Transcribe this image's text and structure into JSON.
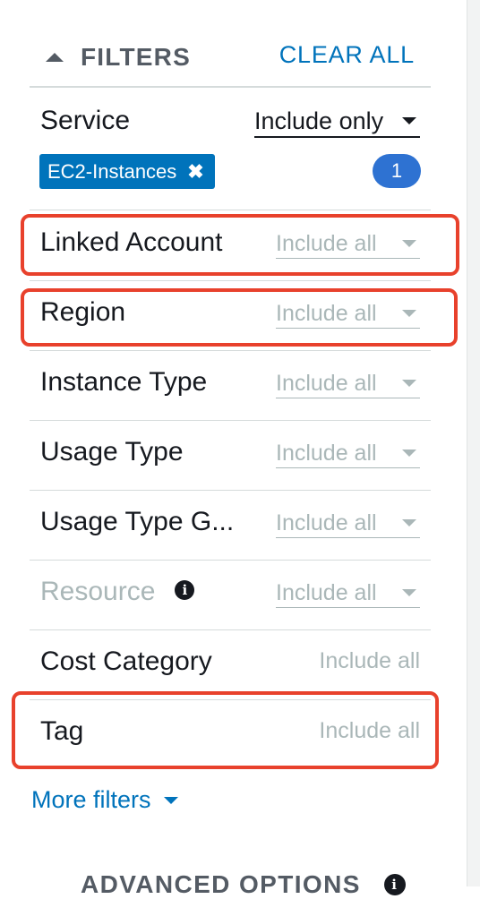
{
  "header": {
    "title": "FILTERS",
    "clear_all": "CLEAR ALL"
  },
  "service": {
    "label": "Service",
    "mode": "Include only",
    "token": "EC2-Instances",
    "token_remove": "✖",
    "count": "1"
  },
  "filters": [
    {
      "label": "Linked Account",
      "mode": "Include all"
    },
    {
      "label": "Region",
      "mode": "Include all"
    },
    {
      "label": "Instance Type",
      "mode": "Include all"
    },
    {
      "label": "Usage Type",
      "mode": "Include all"
    },
    {
      "label": "Usage Type G...",
      "mode": "Include all"
    },
    {
      "label": "Resource",
      "mode": "Include all",
      "info": "i"
    },
    {
      "label": "Cost Category",
      "mode": "Include all"
    },
    {
      "label": "Tag",
      "mode": "Include all"
    }
  ],
  "more_filters": "More filters",
  "advanced": {
    "title": "ADVANCED OPTIONS",
    "info": "i"
  },
  "colors": {
    "link": "#0073bb",
    "token": "#0073bb",
    "badge": "#2e72d2",
    "highlight": "#e8412c"
  }
}
